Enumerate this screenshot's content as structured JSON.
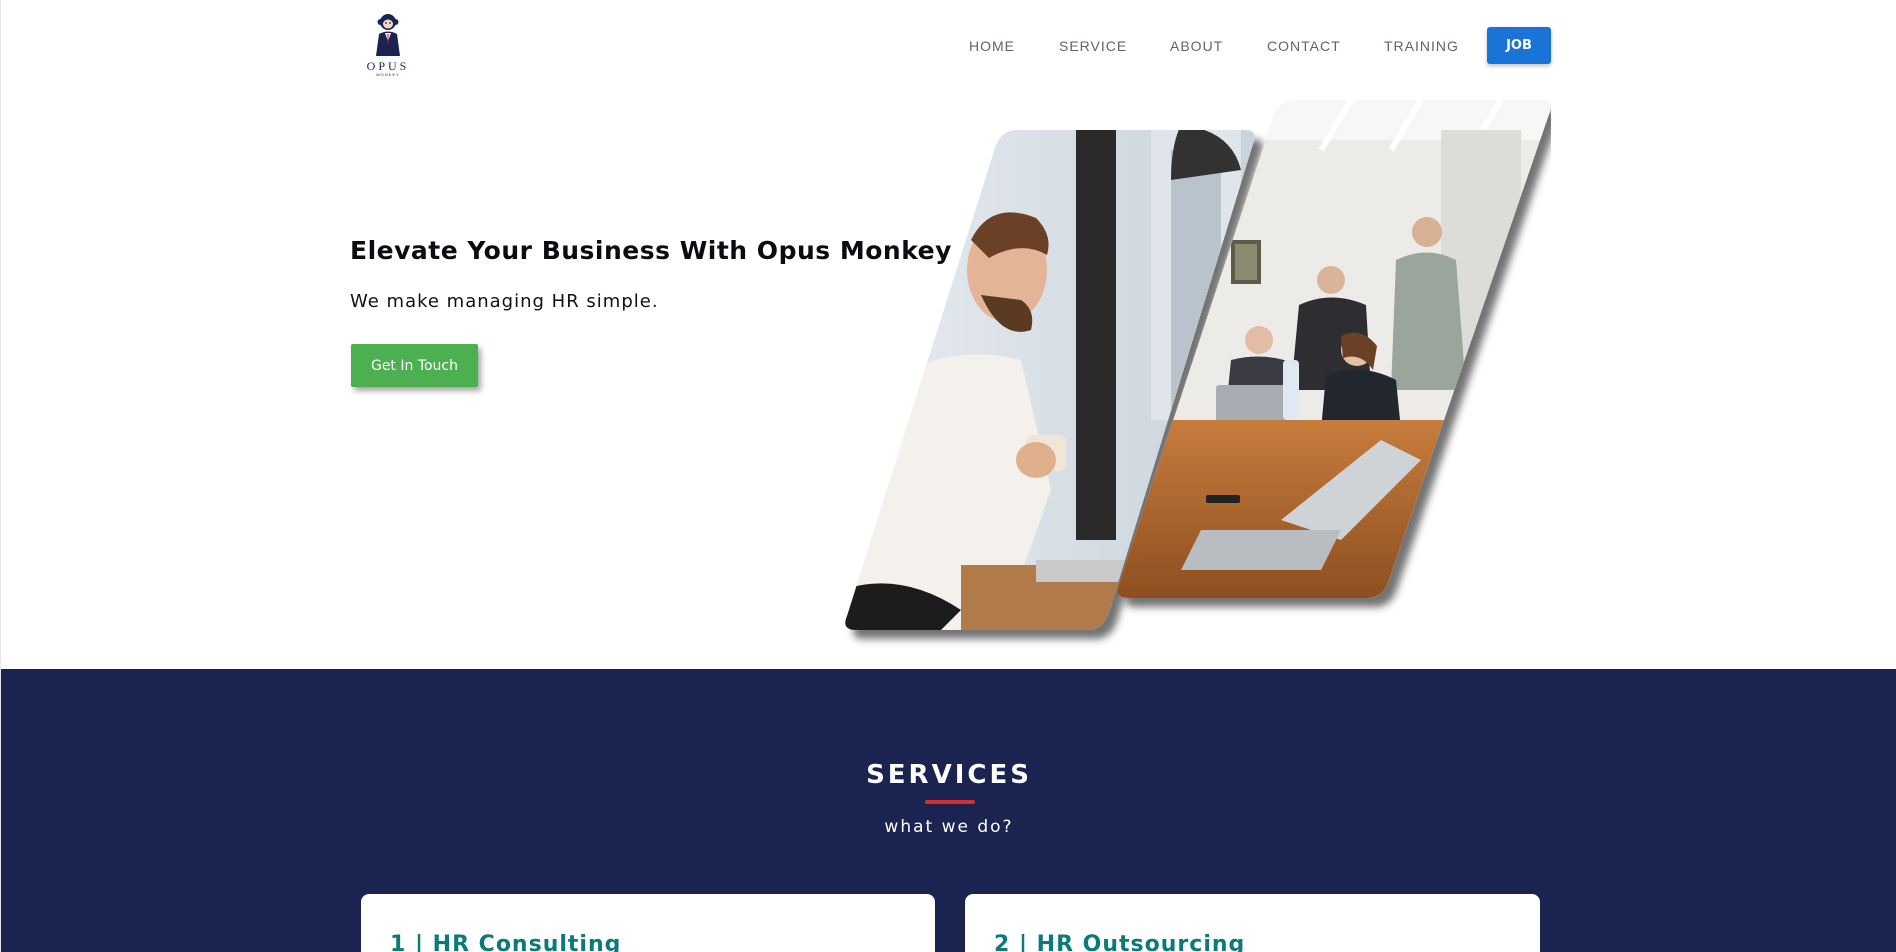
{
  "brand": {
    "logo_word": "OPUS",
    "logo_sub": "MONKEY"
  },
  "nav": {
    "items": [
      {
        "label": "HOME"
      },
      {
        "label": "SERVICE"
      },
      {
        "label": "ABOUT"
      },
      {
        "label": "CONTACT"
      },
      {
        "label": "TRAINING"
      }
    ],
    "job_label": "JOB"
  },
  "hero": {
    "title": "Elevate Your Business With Opus Monkey",
    "subtitle": "We make managing HR simple.",
    "cta_label": "Get In Touch",
    "images": [
      "photo-man-with-coffee-at-laptop",
      "photo-team-meeting-around-laptops"
    ]
  },
  "services": {
    "title": "SERVICES",
    "subtitle": "what we do?",
    "cards": [
      {
        "title": "1 | HR Consulting"
      },
      {
        "title": "2 | HR Outsourcing"
      }
    ]
  },
  "colors": {
    "navy": "#1b2351",
    "job_blue": "#1a73d6",
    "cta_green": "#4caf50",
    "accent_red": "#d32f2f",
    "card_title_teal": "#0b7a78"
  }
}
